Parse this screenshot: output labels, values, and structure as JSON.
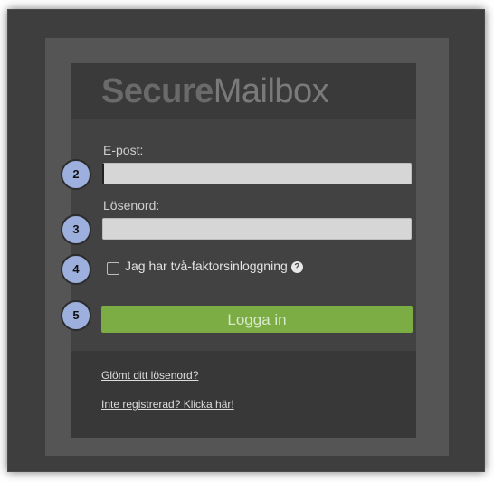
{
  "app": {
    "logo_bold": "Secure",
    "logo_light": "Mailbox"
  },
  "form": {
    "email_label": "E-post:",
    "email_value": "",
    "password_label": "Lösenord:",
    "password_value": "",
    "two_factor_label": "Jag har två-faktorsinloggning",
    "two_factor_checked": false,
    "help_icon": "question-circle-icon",
    "login_button": "Logga in"
  },
  "links": {
    "forgot_password": "Glömt ditt lösenord?",
    "register": "Inte registrerad? Klicka här!"
  },
  "markers": [
    "2",
    "3",
    "4",
    "5"
  ],
  "colors": {
    "login_button": "#7cad45",
    "marker": "#9db0dd",
    "panel": "#424242"
  }
}
